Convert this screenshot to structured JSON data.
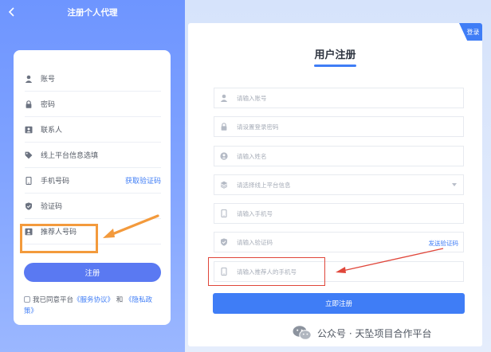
{
  "mobile": {
    "back_icon": "chevron-left-icon",
    "title": "注册个人代理",
    "fields": [
      {
        "key": "account",
        "label": "账号",
        "icon": "user-icon"
      },
      {
        "key": "password",
        "label": "密码",
        "icon": "lock-icon"
      },
      {
        "key": "contact",
        "label": "联系人",
        "icon": "contact-card-icon"
      },
      {
        "key": "platform",
        "label": "线上平台信息选填",
        "icon": "tag-icon"
      },
      {
        "key": "phone",
        "label": "手机号码",
        "icon": "phone-icon",
        "action": "获取验证码"
      },
      {
        "key": "code",
        "label": "验证码",
        "icon": "shield-icon"
      },
      {
        "key": "referrer",
        "label": "推荐人号码",
        "icon": "referrer-card-icon"
      }
    ],
    "submit_label": "注册",
    "agreement": {
      "prefix": "我已同意平台",
      "terms": "《服务协议》",
      "and": "和",
      "privacy_a": "《隐私政",
      "privacy_b": "策》"
    },
    "highlight_color": "#f39a3c"
  },
  "desktop": {
    "corner_label": "登录",
    "title": "用户注册",
    "fields": [
      {
        "key": "account",
        "placeholder": "请输入账号",
        "icon": "user-icon"
      },
      {
        "key": "password",
        "placeholder": "请设置登录密码",
        "icon": "lock-icon"
      },
      {
        "key": "name",
        "placeholder": "请输入姓名",
        "icon": "person-circle-icon"
      },
      {
        "key": "platform",
        "placeholder": "请选择线上平台信息",
        "icon": "layers-icon",
        "dropdown": true
      },
      {
        "key": "phone",
        "placeholder": "请输入手机号",
        "icon": "phone-icon"
      },
      {
        "key": "code",
        "placeholder": "请输入验证码",
        "icon": "shield-icon",
        "action": "发送验证码"
      },
      {
        "key": "referrer",
        "placeholder": "请输入推荐人的手机号",
        "icon": "phone-icon"
      }
    ],
    "submit_label": "立即注册",
    "highlight_color": "#e0463a",
    "accent_color": "#3f7df6"
  },
  "watermark": {
    "icon": "wechat-icon",
    "text": "公众号 · 天坠项目合作平台"
  }
}
